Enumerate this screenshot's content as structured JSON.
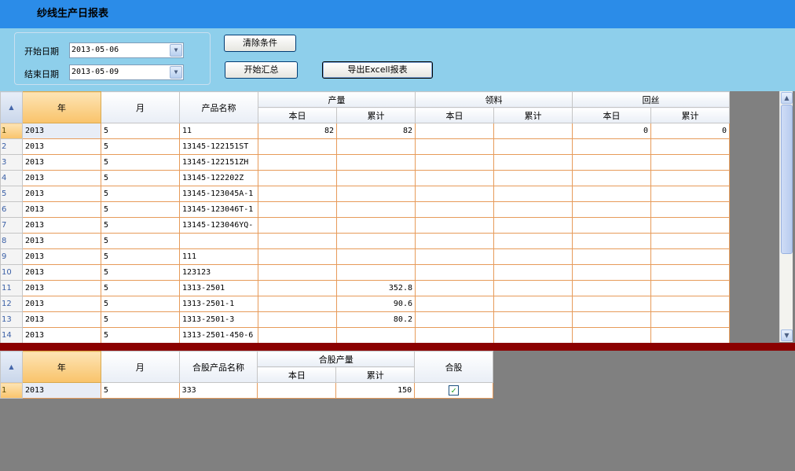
{
  "title": "纱线生产日报表",
  "filters": {
    "start_label": "开始日期",
    "start_value": "2013-05-06",
    "end_label": "结束日期",
    "end_value": "2013-05-09"
  },
  "buttons": {
    "clear": "清除条件",
    "summarize": "开始汇总",
    "export": "导出Excell报表"
  },
  "main_grid": {
    "headers": {
      "year": "年",
      "month": "月",
      "product": "产品名称",
      "output": "产量",
      "material": "领料",
      "return": "回丝",
      "today": "本日",
      "cumulative": "累计"
    },
    "rows": [
      {
        "n": "1",
        "year": "2013",
        "month": "5",
        "product": "11",
        "out_day": "82",
        "out_cum": "82",
        "mat_day": "",
        "mat_cum": "",
        "ret_day": "0",
        "ret_cum": "0"
      },
      {
        "n": "2",
        "year": "2013",
        "month": "5",
        "product": "13145-122151ST",
        "out_day": "",
        "out_cum": "",
        "mat_day": "",
        "mat_cum": "",
        "ret_day": "",
        "ret_cum": ""
      },
      {
        "n": "3",
        "year": "2013",
        "month": "5",
        "product": "13145-122151ZH",
        "out_day": "",
        "out_cum": "",
        "mat_day": "",
        "mat_cum": "",
        "ret_day": "",
        "ret_cum": ""
      },
      {
        "n": "4",
        "year": "2013",
        "month": "5",
        "product": "13145-122202Z",
        "out_day": "",
        "out_cum": "",
        "mat_day": "",
        "mat_cum": "",
        "ret_day": "",
        "ret_cum": ""
      },
      {
        "n": "5",
        "year": "2013",
        "month": "5",
        "product": "13145-123045A-1",
        "out_day": "",
        "out_cum": "",
        "mat_day": "",
        "mat_cum": "",
        "ret_day": "",
        "ret_cum": ""
      },
      {
        "n": "6",
        "year": "2013",
        "month": "5",
        "product": "13145-123046T-1",
        "out_day": "",
        "out_cum": "",
        "mat_day": "",
        "mat_cum": "",
        "ret_day": "",
        "ret_cum": ""
      },
      {
        "n": "7",
        "year": "2013",
        "month": "5",
        "product": "13145-123046YQ-",
        "out_day": "",
        "out_cum": "",
        "mat_day": "",
        "mat_cum": "",
        "ret_day": "",
        "ret_cum": ""
      },
      {
        "n": "8",
        "year": "2013",
        "month": "5",
        "product": "",
        "out_day": "",
        "out_cum": "",
        "mat_day": "",
        "mat_cum": "",
        "ret_day": "",
        "ret_cum": ""
      },
      {
        "n": "9",
        "year": "2013",
        "month": "5",
        "product": "111",
        "out_day": "",
        "out_cum": "",
        "mat_day": "",
        "mat_cum": "",
        "ret_day": "",
        "ret_cum": ""
      },
      {
        "n": "10",
        "year": "2013",
        "month": "5",
        "product": "123123",
        "out_day": "",
        "out_cum": "",
        "mat_day": "",
        "mat_cum": "",
        "ret_day": "",
        "ret_cum": ""
      },
      {
        "n": "11",
        "year": "2013",
        "month": "5",
        "product": "1313-2501",
        "out_day": "",
        "out_cum": "352.8",
        "mat_day": "",
        "mat_cum": "",
        "ret_day": "",
        "ret_cum": ""
      },
      {
        "n": "12",
        "year": "2013",
        "month": "5",
        "product": "1313-2501-1",
        "out_day": "",
        "out_cum": "90.6",
        "mat_day": "",
        "mat_cum": "",
        "ret_day": "",
        "ret_cum": ""
      },
      {
        "n": "13",
        "year": "2013",
        "month": "5",
        "product": "1313-2501-3",
        "out_day": "",
        "out_cum": "80.2",
        "mat_day": "",
        "mat_cum": "",
        "ret_day": "",
        "ret_cum": ""
      },
      {
        "n": "14",
        "year": "2013",
        "month": "5",
        "product": "1313-2501-450-6",
        "out_day": "",
        "out_cum": "",
        "mat_day": "",
        "mat_cum": "",
        "ret_day": "",
        "ret_cum": ""
      }
    ]
  },
  "plied_grid": {
    "headers": {
      "year": "年",
      "month": "月",
      "product": "合股产品名称",
      "output": "合股产量",
      "today": "本日",
      "cumulative": "累计",
      "plied": "合股"
    },
    "rows": [
      {
        "n": "1",
        "year": "2013",
        "month": "5",
        "product": "333",
        "out_day": "",
        "out_cum": "150",
        "plied": true
      }
    ]
  },
  "icons": {
    "corner": "sort-triangle-icon",
    "dropdown": "chevron-down-icon",
    "checkbox": "checkmark-icon"
  }
}
